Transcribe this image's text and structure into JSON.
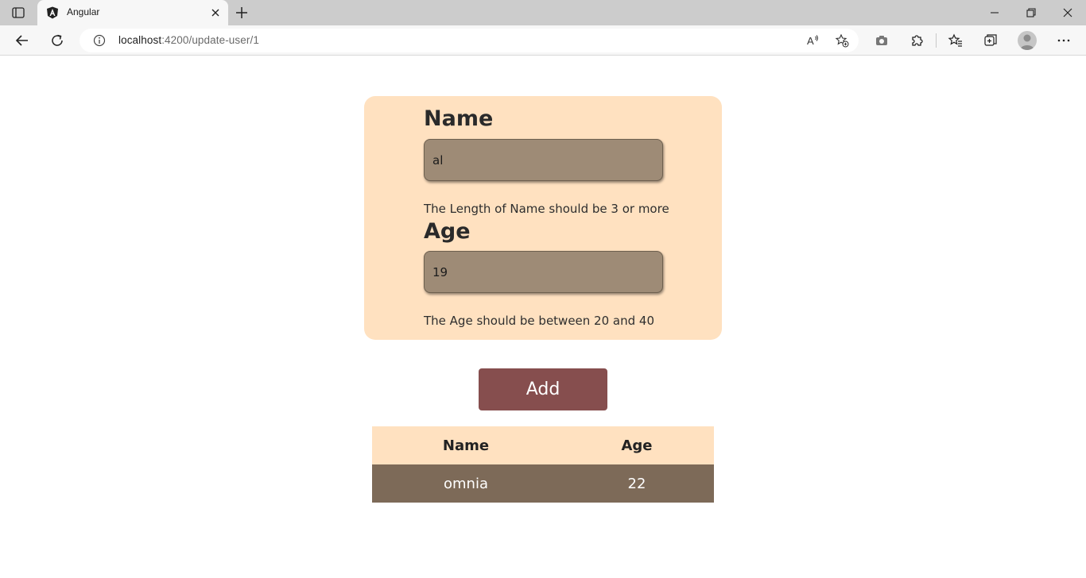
{
  "browser": {
    "tab_title": "Angular",
    "url_host": "localhost",
    "url_path": ":4200/update-user/1",
    "read_aloud_label": "A",
    "icons": [
      "tab-actions-icon",
      "angular-logo-icon",
      "close-icon",
      "new-tab-icon",
      "minimize-icon",
      "restore-icon",
      "window-close-icon",
      "back-icon",
      "refresh-icon",
      "info-icon",
      "read-aloud-icon",
      "add-favorite-icon",
      "screenshot-icon",
      "extensions-icon",
      "favorites-icon",
      "collections-icon",
      "profile-avatar",
      "more-icon"
    ]
  },
  "form": {
    "name_label": "Name",
    "name_value": "al",
    "name_error": "The Length of Name should be 3 or more",
    "age_label": "Age",
    "age_value": "19",
    "age_error": "The Age should be between 20 and 40",
    "add_label": "Add"
  },
  "table": {
    "headers": [
      "Name",
      "Age"
    ],
    "rows": [
      [
        "omnia",
        "22"
      ]
    ]
  },
  "colors": {
    "card_bg": "#ffe1c0",
    "input_bg": "#9e8b76",
    "button_bg": "#864e4e",
    "row_bg": "#7d6a58"
  }
}
